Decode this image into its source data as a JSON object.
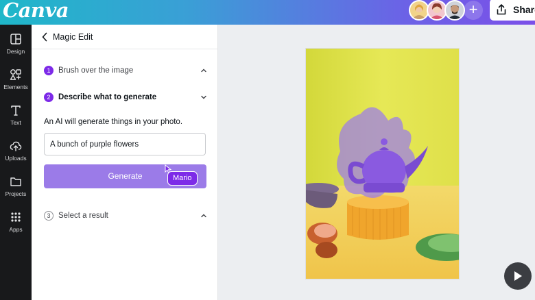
{
  "app": {
    "logo_text": "Canva"
  },
  "header": {
    "share_label": "Share",
    "add_collaborator_symbol": "+",
    "avatars": [
      {
        "name": "collaborator-1",
        "color": "#e8b34b"
      },
      {
        "name": "collaborator-2",
        "color": "#d86a8a"
      },
      {
        "name": "collaborator-3",
        "color": "#5a4a3e"
      }
    ]
  },
  "rail": {
    "items": [
      {
        "label": "Design",
        "icon": "layout-icon"
      },
      {
        "label": "Elements",
        "icon": "shapes-icon"
      },
      {
        "label": "Text",
        "icon": "text-icon"
      },
      {
        "label": "Uploads",
        "icon": "cloud-upload-icon"
      },
      {
        "label": "Projects",
        "icon": "folder-icon"
      },
      {
        "label": "Apps",
        "icon": "grid-icon"
      }
    ]
  },
  "panel": {
    "title": "Magic Edit",
    "steps": [
      {
        "number": "1",
        "label": "Brush over the image",
        "expanded": false
      },
      {
        "number": "2",
        "label": "Describe what to generate",
        "expanded": true
      },
      {
        "number": "3",
        "label": "Select a result",
        "expanded": false
      }
    ],
    "description": "An AI will generate things in your photo.",
    "prompt_value": "A bunch of purple flowers",
    "generate_label": "Generate",
    "cursor_user": "Mario"
  },
  "colors": {
    "accent": "#7d2ae8",
    "generate_button": "#9b7be8",
    "artboard_background": "#e2e24a",
    "teapot": "#8a5ae0"
  }
}
